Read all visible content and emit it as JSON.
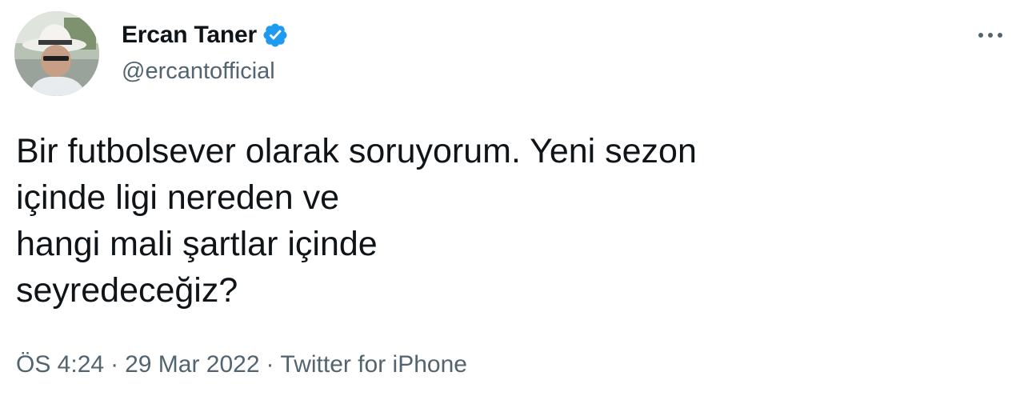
{
  "author": {
    "display_name": "Ercan Taner",
    "handle": "@ercantofficial",
    "verified": true
  },
  "tweet": {
    "lines": [
      "Bir futbolsever olarak soruyorum. Yeni sezon",
      "içinde ligi nereden ve",
      "hangi mali şartlar içinde",
      "seyredeceğiz?"
    ]
  },
  "meta": {
    "time": "ÖS 4:24",
    "separator": "·",
    "date": "29 Mar 2022",
    "source": "Twitter for iPhone"
  },
  "icons": {
    "verified": "verified-badge-icon",
    "more": "more-options-icon"
  },
  "colors": {
    "text_primary": "#0f1419",
    "text_secondary": "#536471",
    "verified_blue": "#1d9bf0",
    "background": "#ffffff"
  }
}
